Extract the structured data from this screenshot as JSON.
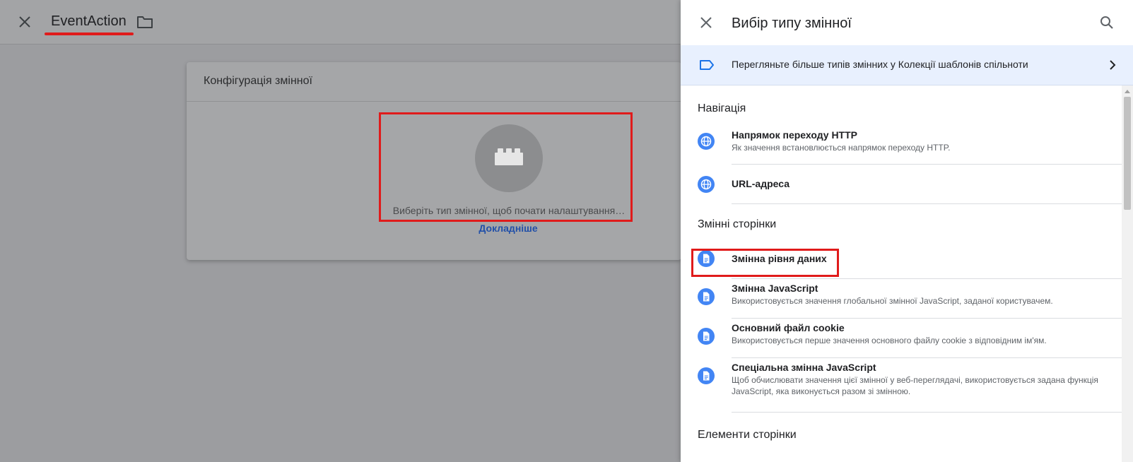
{
  "editor": {
    "title": "EventAction",
    "config_card": {
      "title": "Конфігурація змінної",
      "hint": "Виберіть тип змінної, щоб почати налаштування…",
      "learn_more": "Докладніше"
    }
  },
  "panel": {
    "title": "Вибір типу змінної",
    "community_banner": "Перегляньте більше типів змінних у Колекції шаблонів спільноти",
    "sections": [
      {
        "title": "Навігація",
        "items": [
          {
            "title": "Напрямок переходу HTTP",
            "description": "Як значення встановлюється напрямок переходу HTTP.",
            "icon": "globe-icon"
          },
          {
            "title": "URL-адреса",
            "description": "",
            "icon": "globe-icon"
          }
        ]
      },
      {
        "title": "Змінні сторінки",
        "items": [
          {
            "title": "Змінна рівня даних",
            "description": "",
            "icon": "document-icon"
          },
          {
            "title": "Змінна JavaScript",
            "description": "Використовується значення глобальної змінної JavaScript, заданої користувачем.",
            "icon": "document-icon"
          },
          {
            "title": "Основний файл cookie",
            "description": "Використовується перше значення основного файлу cookie з відповідним ім'ям.",
            "icon": "document-icon"
          },
          {
            "title": "Спеціальна змінна JavaScript",
            "description": "Щоб обчислювати значення цієї змінної у веб-переглядачі, використовується задана функція JavaScript, яка виконується разом зі змінною.",
            "icon": "document-icon"
          }
        ]
      },
      {
        "title": "Елементи сторінки",
        "items": []
      }
    ]
  },
  "colors": {
    "accent_blue": "#4285f4",
    "annotation_red": "#e01b1b",
    "banner_bg": "#e8f0fe",
    "link_blue": "#1a73e8"
  }
}
